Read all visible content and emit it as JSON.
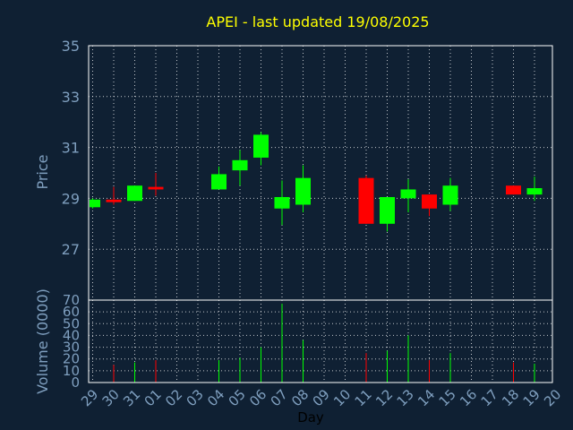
{
  "chart_data": [
    {
      "type": "candlestick",
      "title": "APEI - last updated 19/08/2025",
      "ylabel": "Price",
      "ylim": [
        25,
        35
      ],
      "yticks": [
        27,
        29,
        31,
        33,
        35
      ],
      "grid": true,
      "colors": {
        "up": "#00ff00",
        "down": "#ff0000",
        "background": "#0f2033",
        "text": "#7f9fbf",
        "title": "#ffff00"
      },
      "candles": [
        {
          "day": "29",
          "open": 28.65,
          "close": 28.95,
          "high": 29.0,
          "low": 28.6
        },
        {
          "day": "30",
          "open": 28.95,
          "close": 28.85,
          "high": 29.45,
          "low": 28.75
        },
        {
          "day": "31",
          "open": 28.9,
          "close": 29.5,
          "high": 29.5,
          "low": 28.9
        },
        {
          "day": "01",
          "open": 29.45,
          "close": 29.35,
          "high": 30.0,
          "low": 29.1
        },
        {
          "day": "04",
          "open": 29.35,
          "close": 29.95,
          "high": 30.25,
          "low": 29.35
        },
        {
          "day": "05",
          "open": 30.1,
          "close": 30.5,
          "high": 30.9,
          "low": 29.5
        },
        {
          "day": "06",
          "open": 30.6,
          "close": 31.5,
          "high": 31.6,
          "low": 30.3
        },
        {
          "day": "07",
          "open": 28.6,
          "close": 29.05,
          "high": 29.7,
          "low": 27.95
        },
        {
          "day": "08",
          "open": 28.75,
          "close": 29.8,
          "high": 30.3,
          "low": 28.45
        },
        {
          "day": "11",
          "open": 29.8,
          "close": 28.0,
          "high": 29.9,
          "low": 28.0
        },
        {
          "day": "12",
          "open": 28.0,
          "close": 29.05,
          "high": 29.05,
          "low": 27.7
        },
        {
          "day": "13",
          "open": 29.0,
          "close": 29.35,
          "high": 29.75,
          "low": 28.45
        },
        {
          "day": "14",
          "open": 29.15,
          "close": 28.6,
          "high": 29.15,
          "low": 28.3
        },
        {
          "day": "15",
          "open": 28.75,
          "close": 29.5,
          "high": 29.8,
          "low": 28.5
        },
        {
          "day": "18",
          "open": 29.5,
          "close": 29.15,
          "high": 29.5,
          "low": 29.15
        },
        {
          "day": "19",
          "open": 29.15,
          "close": 29.4,
          "high": 29.85,
          "low": 28.9
        }
      ]
    },
    {
      "type": "bar",
      "ylabel": "Volume (0000)",
      "xlabel": "Day",
      "ylim": [
        0,
        70
      ],
      "yticks": [
        0,
        10,
        20,
        30,
        40,
        50,
        60,
        70
      ],
      "grid": true,
      "categories": [
        "29",
        "30",
        "31",
        "01",
        "02",
        "03",
        "04",
        "05",
        "06",
        "07",
        "08",
        "09",
        "10",
        "11",
        "12",
        "13",
        "14",
        "15",
        "16",
        "17",
        "18",
        "19",
        "20"
      ],
      "values": [
        {
          "day": "30",
          "value": 15,
          "direction": "down"
        },
        {
          "day": "31",
          "value": 17,
          "direction": "up"
        },
        {
          "day": "01",
          "value": 19,
          "direction": "down"
        },
        {
          "day": "04",
          "value": 19,
          "direction": "up"
        },
        {
          "day": "05",
          "value": 21,
          "direction": "up"
        },
        {
          "day": "06",
          "value": 30,
          "direction": "up"
        },
        {
          "day": "07",
          "value": 67,
          "direction": "up"
        },
        {
          "day": "08",
          "value": 36,
          "direction": "up"
        },
        {
          "day": "11",
          "value": 25,
          "direction": "down"
        },
        {
          "day": "12",
          "value": 27,
          "direction": "up"
        },
        {
          "day": "13",
          "value": 40,
          "direction": "up"
        },
        {
          "day": "14",
          "value": 19,
          "direction": "down"
        },
        {
          "day": "15",
          "value": 25,
          "direction": "up"
        },
        {
          "day": "18",
          "value": 17,
          "direction": "down"
        },
        {
          "day": "19",
          "value": 16,
          "direction": "up"
        }
      ]
    }
  ]
}
